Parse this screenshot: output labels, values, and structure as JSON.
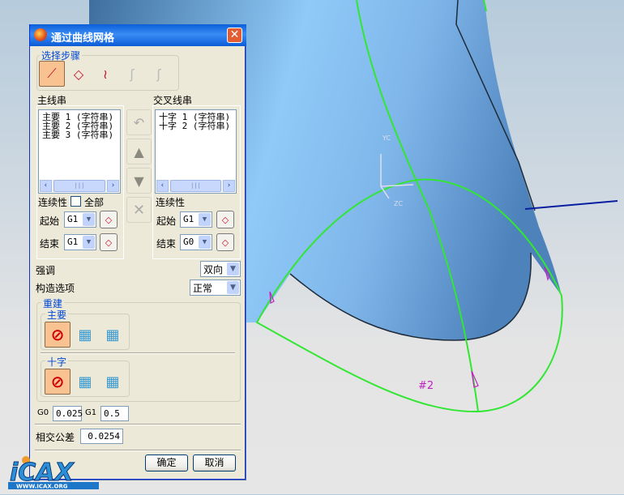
{
  "viewport": {
    "curve_label": "#2",
    "axis_labels": {
      "y": "YC",
      "z": "ZC"
    },
    "colors": {
      "surface": "#6fa8e0",
      "curve": "#33e633",
      "edge": "#1f2b3a",
      "axis": "#0a1fa0"
    }
  },
  "logo": {
    "text": "iCAX",
    "url_text": "WWW.ICAX.ORG"
  },
  "dialog": {
    "title": "通过曲线网格",
    "close_icon": "close-icon",
    "steps": {
      "label": "选择步骤",
      "icons": [
        "primary-curves-icon",
        "cross-curves-icon",
        "spine-icon",
        "constraint-face-icon",
        "constraint-face-2-icon"
      ]
    },
    "primary": {
      "label": "主线串",
      "items": [
        "主要 1 (字符串)",
        "主要 2 (字符串)",
        "主要 3 (字符串)"
      ],
      "continuity_label": "连续性",
      "all_label": "全部",
      "all_checked": false,
      "start_label": "起始",
      "start_value": "G1",
      "end_label": "结束",
      "end_value": "G1"
    },
    "cross": {
      "label": "交叉线串",
      "items": [
        "十字 1 (字符串)",
        "十字 2 (字符串)"
      ],
      "continuity_label": "连续性",
      "start_label": "起始",
      "start_value": "G1",
      "end_label": "结束",
      "end_value": "G0"
    },
    "emphasis": {
      "label": "强调",
      "value": "双向"
    },
    "construction": {
      "label": "构造选项",
      "value": "正常"
    },
    "rebuild": {
      "label": "重建",
      "primary_label": "主要",
      "cross_label": "十字"
    },
    "tolerances": {
      "g0_label": "G0",
      "g0_value": "0.025",
      "g1_label": "G1",
      "g1_value": "0.5"
    },
    "intersection": {
      "label": "相交公差",
      "value": "0.0254"
    },
    "ok_label": "确定",
    "cancel_label": "取消"
  }
}
